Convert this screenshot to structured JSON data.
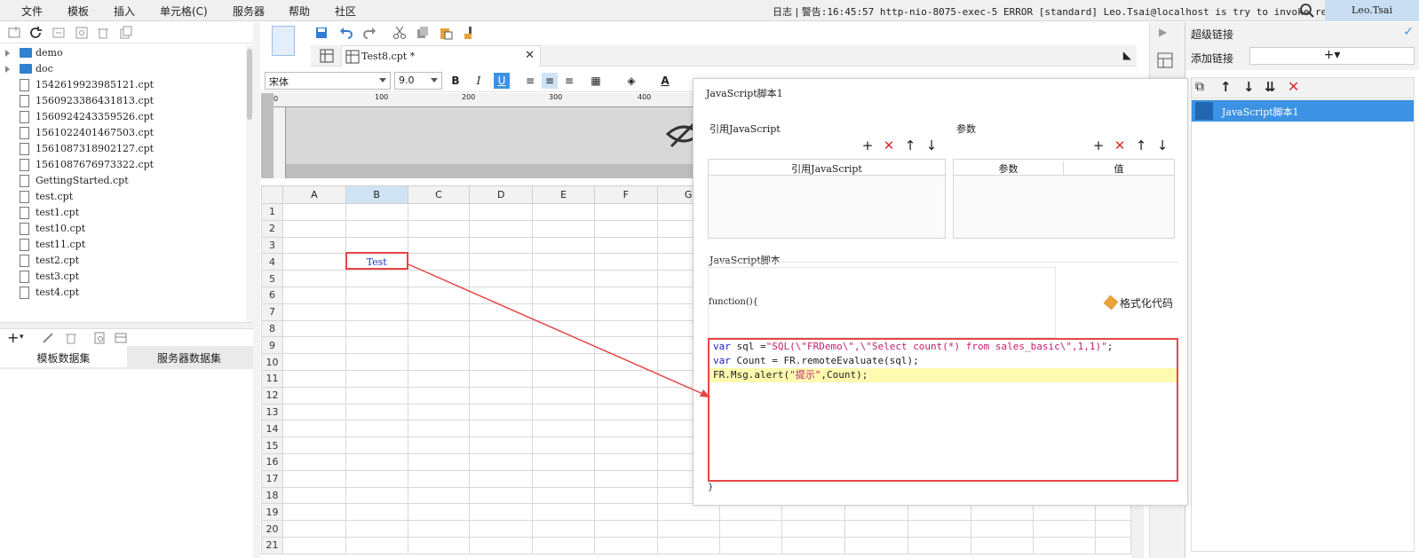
{
  "menubar": {
    "items": [
      "文件",
      "模板",
      "插入",
      "单元格(C)",
      "服务器",
      "帮助",
      "社区"
    ],
    "log_label": "日志",
    "log_text": "警告:16:45:57 http-nio-8075-exec-5 ERROR [standard] Leo.Tsai@localhost is try to invoke re...",
    "user": "Leo.Tsai"
  },
  "file_tree": {
    "folders": [
      "demo",
      "doc"
    ],
    "files": [
      "1542619923985121.cpt",
      "1560923386431813.cpt",
      "1560924243359526.cpt",
      "1561022401467503.cpt",
      "1561087318902127.cpt",
      "1561087676973322.cpt",
      "GettingStarted.cpt",
      "test.cpt",
      "test1.cpt",
      "test10.cpt",
      "test11.cpt",
      "test2.cpt",
      "test3.cpt",
      "test4.cpt"
    ]
  },
  "dataset_tabs": [
    "模板数据集",
    "服务器数据集"
  ],
  "editor": {
    "tab_name": "Test8.cpt *",
    "font_name": "宋体",
    "font_size": "9.0",
    "ruler_marks": [
      "0",
      "100",
      "200",
      "300",
      "400"
    ],
    "columns": [
      "A",
      "B",
      "C",
      "D",
      "E",
      "F",
      "G"
    ],
    "rows": [
      "1",
      "2",
      "3",
      "4",
      "5",
      "6",
      "7",
      "8",
      "9",
      "10",
      "11",
      "12",
      "13",
      "14",
      "15",
      "16",
      "17",
      "18",
      "19",
      "20",
      "21"
    ],
    "cell_b4": "Test"
  },
  "right_panel": {
    "title": "超级链接",
    "add_label": "添加链接",
    "add_value": "+▾",
    "item_label": "JavaScript脚本1"
  },
  "dialog": {
    "title": "JavaScript脚本1",
    "ref_js_label": "引用JavaScript",
    "params_label": "参数",
    "ref_js_col": "引用JavaScript",
    "param_col": "参数",
    "value_col": "值",
    "script_label": "JavaScript脚本",
    "fn_open": "function(){",
    "fn_close": "}",
    "format_label": "格式化代码",
    "code": [
      {
        "kw": "var",
        "rest": " sql =",
        "str": "\"SQL(\\\"FRDemo\\\",\\\"Select count(*) from sales_basic\\\",1,1)\"",
        "tail": ";"
      },
      {
        "kw": "var",
        "rest": " Count = FR.remoteEvaluate(sql);",
        "str": "",
        "tail": ""
      },
      {
        "kw": "",
        "rest": "FR.Msg.alert(",
        "str": "\"提示\"",
        "tail": ",Count);"
      }
    ]
  },
  "colors": {
    "accent": "#3c92e3",
    "annotation": "#e84545",
    "highlight_line": "#fffab0"
  }
}
